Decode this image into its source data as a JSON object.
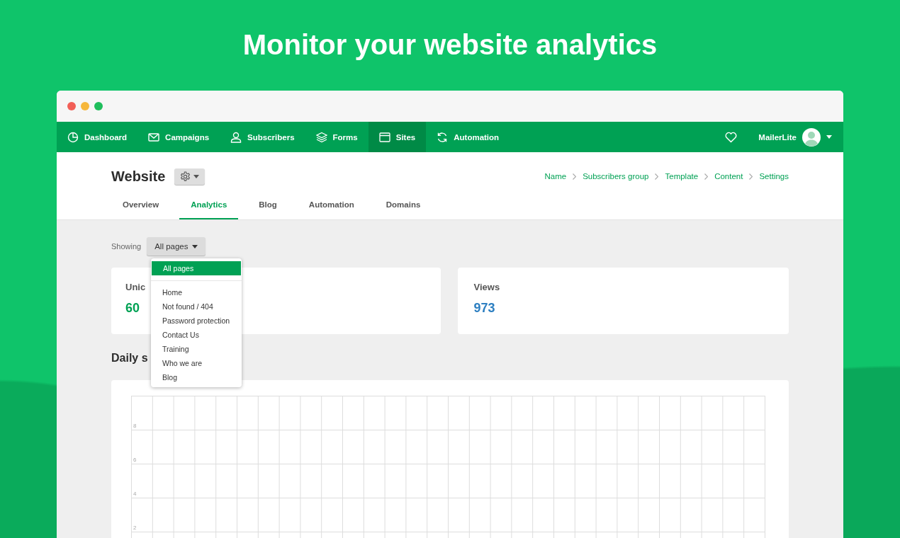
{
  "headline": "Monitor your website analytics",
  "nav": {
    "items": [
      {
        "label": "Dashboard",
        "selected": false
      },
      {
        "label": "Campaigns",
        "selected": false
      },
      {
        "label": "Subscribers",
        "selected": false
      },
      {
        "label": "Forms",
        "selected": false
      },
      {
        "label": "Sites",
        "selected": true
      },
      {
        "label": "Automation",
        "selected": false
      }
    ],
    "account": "MailerLite"
  },
  "page": {
    "title": "Website",
    "breadcrumbs": [
      "Name",
      "Subscribers group",
      "Template",
      "Content",
      "Settings"
    ],
    "tabs": [
      {
        "label": "Overview",
        "selected": false
      },
      {
        "label": "Analytics",
        "selected": true
      },
      {
        "label": "Blog",
        "selected": false
      },
      {
        "label": "Automation",
        "selected": false
      },
      {
        "label": "Domains",
        "selected": false
      }
    ]
  },
  "filter": {
    "label": "Showing",
    "value": "All pages",
    "options": [
      {
        "label": "All pages",
        "selected": true
      },
      {
        "label": "Home",
        "selected": false
      },
      {
        "label": "Not found / 404",
        "selected": false
      },
      {
        "label": "Password protection",
        "selected": false
      },
      {
        "label": "Contact Us",
        "selected": false
      },
      {
        "label": "Training",
        "selected": false
      },
      {
        "label": "Who we are",
        "selected": false
      },
      {
        "label": "Blog",
        "selected": false
      }
    ]
  },
  "stats": [
    {
      "label": "Unic",
      "value": "60",
      "color": "#00a154"
    },
    {
      "label": "Views",
      "value": "973",
      "color": "#2d7fc1"
    }
  ],
  "daily": {
    "title": "Daily s",
    "y_labels": [
      "8",
      "6",
      "4",
      "2"
    ]
  }
}
